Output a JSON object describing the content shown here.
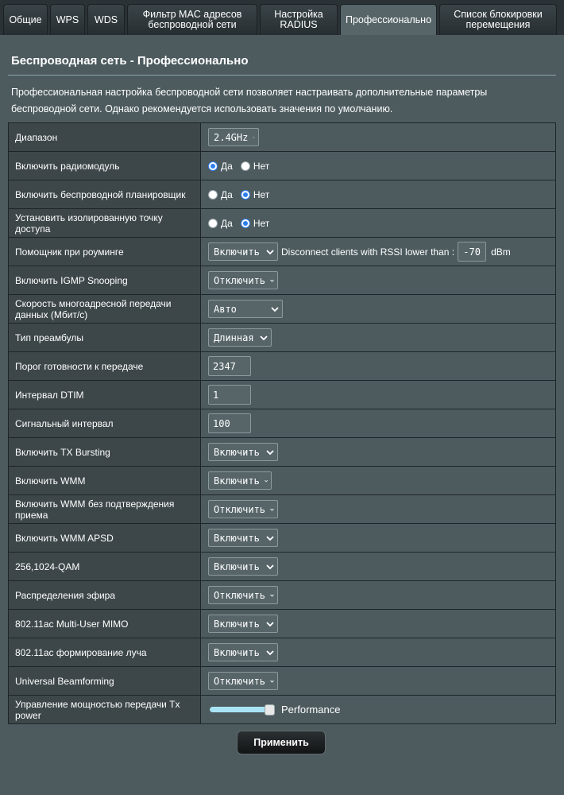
{
  "tabs": [
    {
      "label": "Общие"
    },
    {
      "label": "WPS"
    },
    {
      "label": "WDS"
    },
    {
      "label": "Фильтр MAC адресов беспроводной сети"
    },
    {
      "label": "Настройка RADIUS"
    },
    {
      "label": "Профессионально"
    },
    {
      "label": "Список блокировки перемещения"
    }
  ],
  "active_tab": "Профессионально",
  "page": {
    "title": "Беспроводная сеть - Профессионально",
    "description": "Профессиональная настройка беспроводной сети позволяет настраивать дополнительные параметры беспроводной сети. Однако рекомендуется использовать значения по умолчанию."
  },
  "radio_labels": {
    "yes": "Да",
    "no": "Нет"
  },
  "settings": {
    "band": {
      "label": "Диапазон",
      "value": "2.4GHz"
    },
    "radio": {
      "label": "Включить радиомодуль",
      "selected": "Да"
    },
    "scheduler": {
      "label": "Включить беспроводной планировщик",
      "selected": "Нет"
    },
    "isolated_ap": {
      "label": "Установить изолированную точку доступа",
      "selected": "Нет"
    },
    "roaming": {
      "label": "Помощник при роуминге",
      "value": "Включить",
      "rssi_text": "Disconnect clients with RSSI lower than :",
      "rssi_value": "-70",
      "rssi_unit": "dBm"
    },
    "igmp": {
      "label": "Включить IGMP Snooping",
      "value": "Отключить"
    },
    "multicast": {
      "label": "Скорость многоадресной передачи данных (Мбит/с)",
      "value": "Авто"
    },
    "preamble": {
      "label": "Тип преамбулы",
      "value": "Длинная"
    },
    "rts": {
      "label": "Порог готовности к передаче",
      "value": "2347"
    },
    "dtim": {
      "label": "Интервал DTIM",
      "value": "1"
    },
    "beacon": {
      "label": "Сигнальный интервал",
      "value": "100"
    },
    "tx_bursting": {
      "label": "Включить TX Bursting",
      "value": "Включить"
    },
    "wmm": {
      "label": "Включить WMM",
      "value": "Включить"
    },
    "wmm_noack": {
      "label": "Включить WMM без подтверждения приема",
      "value": "Отключить"
    },
    "wmm_apsd": {
      "label": "Включить WMM APSD",
      "value": "Включить"
    },
    "qam": {
      "label": "256,1024-QAM",
      "value": "Включить"
    },
    "airtime": {
      "label": "Распределения эфира",
      "value": "Отключить"
    },
    "mu_mimo": {
      "label": "802.11ac Multi-User MIMO",
      "value": "Включить"
    },
    "beamforming": {
      "label": "802.11ac формирование луча",
      "value": "Включить"
    },
    "universal_bf": {
      "label": "Universal Beamforming",
      "value": "Отключить"
    },
    "tx_power": {
      "label": "Управление мощностью передачи Tx power",
      "value_label": "Performance",
      "level": 1.0
    }
  },
  "apply_label": "Применить",
  "colors": {
    "accent_radio": "#2e7ef0",
    "slider_fill": "#a9e4f5",
    "panel_bg": "#4d5b5f",
    "label_bg": "#3d474a"
  }
}
